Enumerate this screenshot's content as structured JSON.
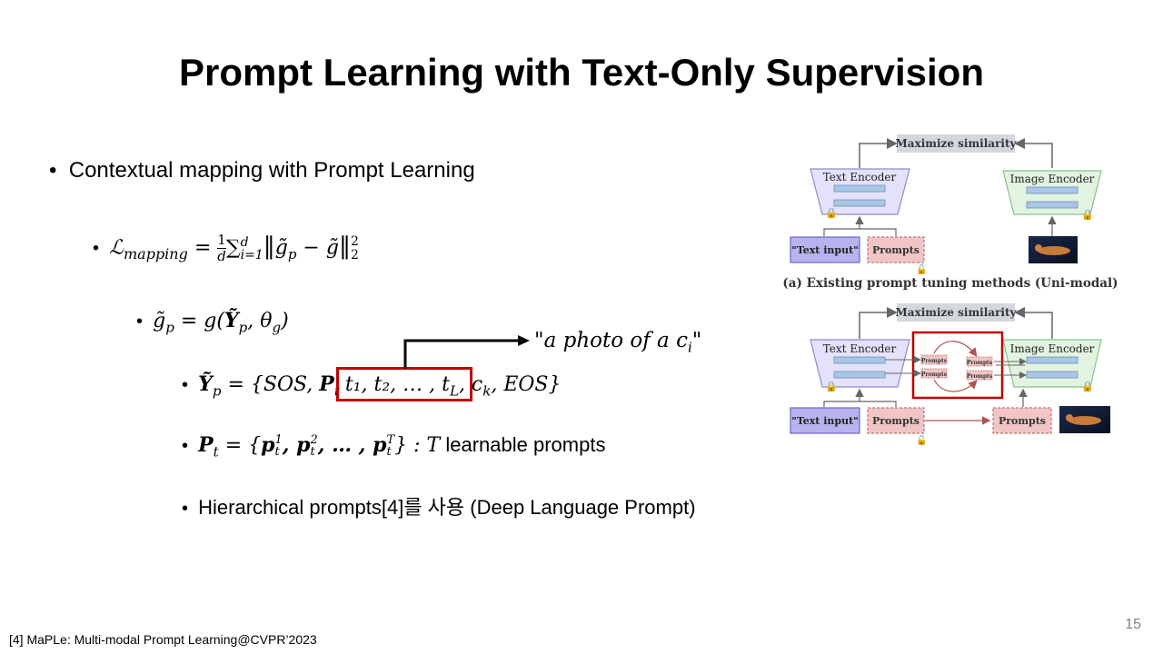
{
  "title": "Prompt Learning with Text-Only Supervision",
  "bullets": {
    "b1": "Contextual mapping with Prompt Learning",
    "b2": {
      "loss_sym": "ℒ",
      "loss_sub": "mapping",
      "eq": " = ",
      "frac_num": "1",
      "frac_den": "d",
      "sum": "∑",
      "sum_sub": "i=1",
      "sum_sup": "d",
      "norm_open": "‖",
      "g_p": "g̃",
      "g_p_sub": "p",
      "minus": " − ",
      "g": "g̃",
      "norm_close": "‖",
      "norm_sup": "2",
      "norm_sub": "2"
    },
    "b3": {
      "lhs": "g̃",
      "lhs_sub": "p",
      "rhs_pre": " = g(",
      "y": "Ỹ",
      "y_sub": "p",
      "comma": ", θ",
      "theta_sub": "g",
      "close": ")"
    },
    "b4": {
      "lhs": "Ỹ",
      "lhs_sub": "p",
      "eq": " = {SOS, ",
      "P": "P",
      "P_sub": "t",
      "boxed": "t₁, t₂, … , t",
      "boxed_L": "L",
      "boxed_c": ", c",
      "boxed_k": "k",
      "tail": ", EOS}",
      "annotation": "\"a photo of  a c",
      "annotation_sub": "i",
      "annotation_end": "\""
    },
    "b5": {
      "lhs": "P",
      "lhs_sub": "t",
      "eq": " = {",
      "p1": "p",
      "p1_sup": "1",
      "p1_sub": "t",
      "p2": ", p",
      "p2_sup": "2",
      "p2_sub": "t",
      "dots": ", … , p",
      "pT_sup": "T",
      "pT_sub": "t",
      "close": "} : ",
      "T": "T",
      "text": " learnable prompts"
    },
    "b6": "Hierarchical prompts[4]를 사용 (Deep Language Prompt)"
  },
  "figure": {
    "top": {
      "maximize": "Maximize similarity",
      "text_encoder": "Text Encoder",
      "image_encoder": "Image Encoder",
      "text_input": "\"Text input\"",
      "prompts": "Prompts",
      "caption": "(a) Existing prompt tuning methods (Uni-modal)"
    },
    "bottom": {
      "maximize": "Maximize similarity",
      "text_encoder": "Text Encoder",
      "image_encoder": "Image Encoder",
      "text_input": "\"Text input\"",
      "prompts_left": "Prompts",
      "prompts_right": "Prompts",
      "mini_prompts_1": "Prompts",
      "mini_prompts_2": "Prompts",
      "mini_prompts_3": "Prompts",
      "mini_prompts_4": "Prompts"
    },
    "colors": {
      "encoder_text_fill": "#e3e2fa",
      "encoder_image_fill": "#e2f3e2",
      "bar_fill": "#a9c6e6",
      "text_input_fill": "#b7b3ee",
      "prompts_fill": "#f1c5c5",
      "maximize_fill": "#d4d7dd",
      "highlight": "#c00000"
    }
  },
  "footnote": "[4] MaPLe: Multi-modal Prompt Learning@CVPR’2023",
  "page_number": "15"
}
